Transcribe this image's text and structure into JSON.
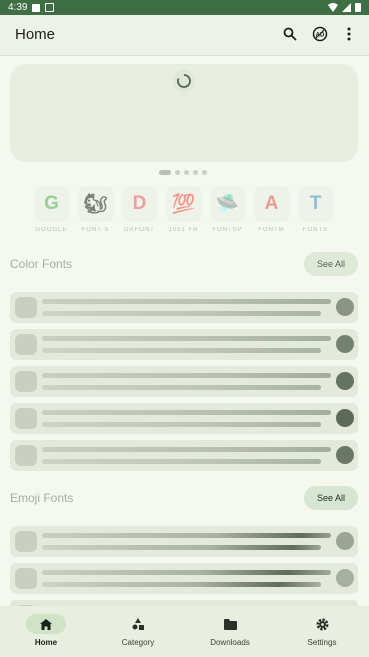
{
  "status": {
    "time": "4:39"
  },
  "appbar": {
    "title": "Home",
    "icons": [
      "search-icon",
      "ad-icon",
      "more-vert-icon"
    ]
  },
  "categories": [
    {
      "glyph": "G",
      "label": "GOOGLE",
      "color": "#4caf50"
    },
    {
      "glyph": "🐿",
      "label": "FONT S",
      "color": "#c27b3a"
    },
    {
      "glyph": "D",
      "label": "DAFONT",
      "color": "#e55a5a"
    },
    {
      "glyph": "💯",
      "label": "1001 FR",
      "color": "#d84a6a"
    },
    {
      "glyph": "🛸",
      "label": "FONTSP",
      "color": "#f0b429"
    },
    {
      "glyph": "A",
      "label": "FONTM",
      "color": "#d9534f"
    },
    {
      "glyph": "T",
      "label": "FONTS",
      "color": "#3a8fd0"
    }
  ],
  "sections": {
    "color": {
      "title": "Color Fonts",
      "see_all": "See All"
    },
    "emoji": {
      "title": "Emoji Fonts",
      "see_all": "See All"
    }
  },
  "nav": [
    {
      "label": "Home",
      "icon": "home-icon",
      "active": true
    },
    {
      "label": "Category",
      "icon": "category-icon",
      "active": false
    },
    {
      "label": "Downloads",
      "icon": "folder-icon",
      "active": false
    },
    {
      "label": "Settings",
      "icon": "gear-icon",
      "active": false
    }
  ]
}
